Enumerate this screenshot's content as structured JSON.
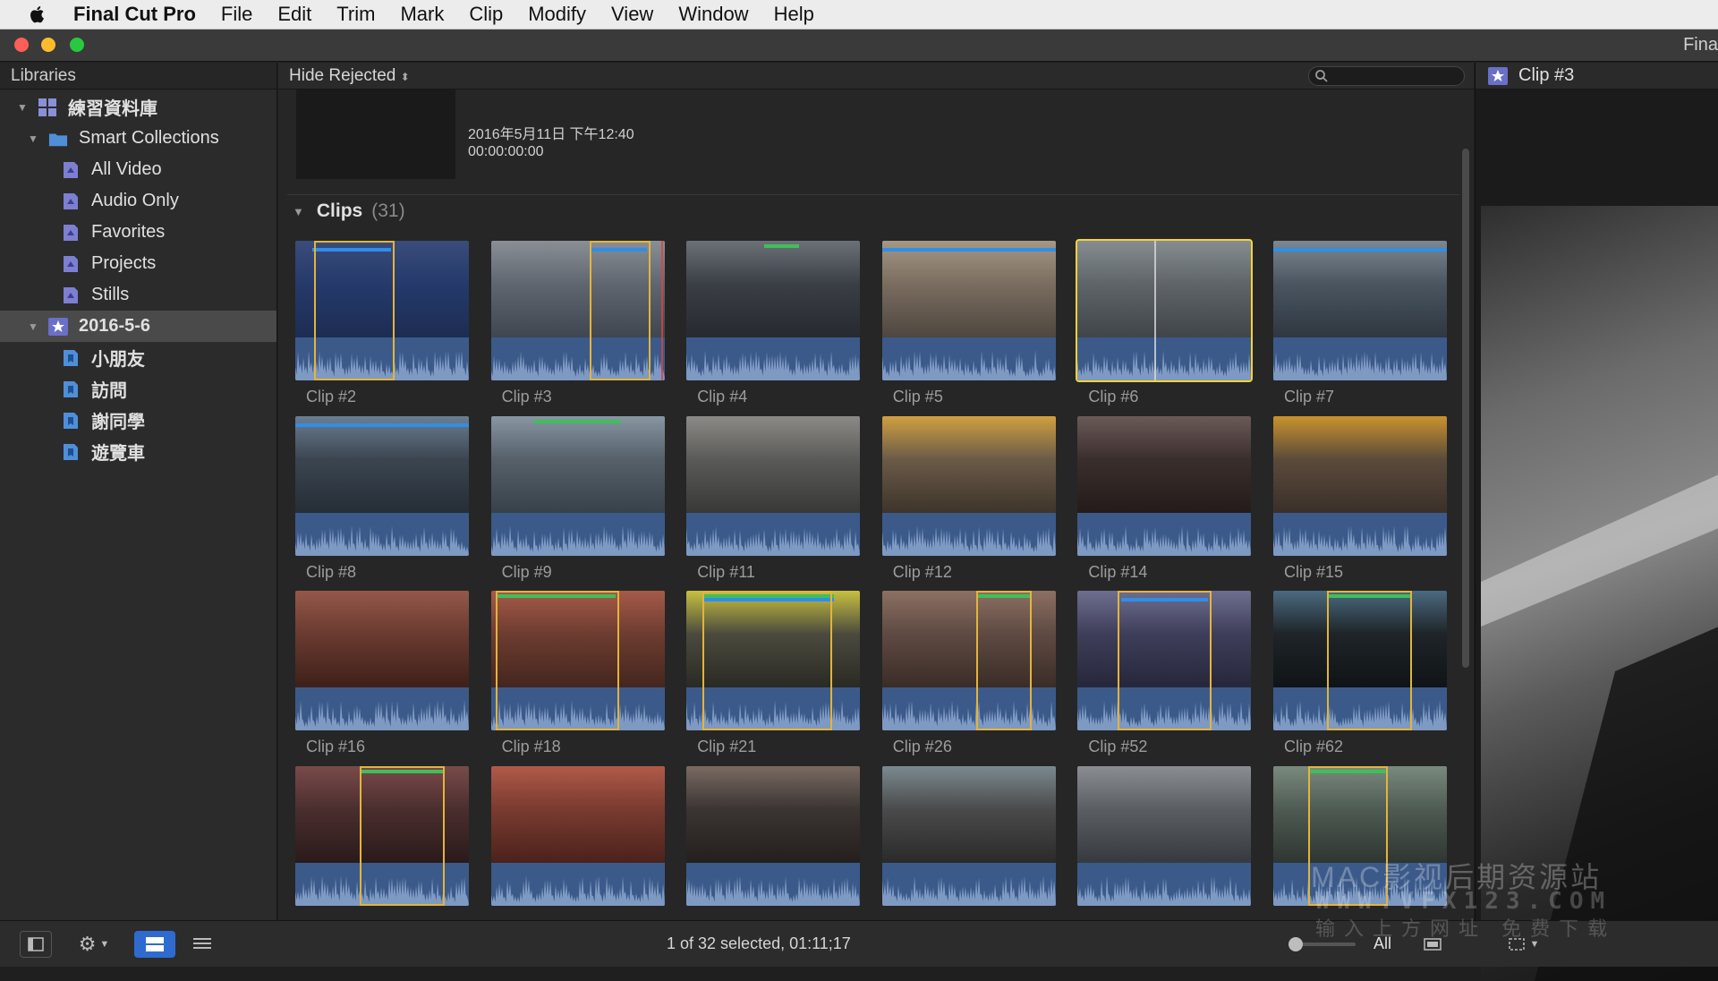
{
  "menubar": {
    "app_name": "Final Cut Pro",
    "items": [
      "File",
      "Edit",
      "Trim",
      "Mark",
      "Clip",
      "Modify",
      "View",
      "Window",
      "Help"
    ]
  },
  "window": {
    "title": "Fina"
  },
  "sidebar": {
    "header": "Libraries",
    "library": "練習資料庫",
    "smart_collections": "Smart Collections",
    "collections": [
      "All Video",
      "Audio Only",
      "Favorites",
      "Projects",
      "Stills"
    ],
    "event": "2016-5-6",
    "keywords": [
      "小朋友",
      "訪問",
      "謝同學",
      "遊覽車"
    ]
  },
  "browser": {
    "filter": "Hide Rejected",
    "event_date": "2016年5月11日 下午12:40",
    "event_timecode": "00:00:00:00",
    "clips_title": "Clips",
    "clips_count": "(31)",
    "clips": [
      {
        "name": "Clip #2"
      },
      {
        "name": "Clip #3"
      },
      {
        "name": "Clip #4"
      },
      {
        "name": "Clip #5"
      },
      {
        "name": "Clip #6"
      },
      {
        "name": "Clip #7"
      },
      {
        "name": "Clip #8"
      },
      {
        "name": "Clip #9"
      },
      {
        "name": "Clip #11"
      },
      {
        "name": "Clip #12"
      },
      {
        "name": "Clip #14"
      },
      {
        "name": "Clip #15"
      },
      {
        "name": "Clip #16"
      },
      {
        "name": "Clip #18"
      },
      {
        "name": "Clip #21"
      },
      {
        "name": "Clip #26"
      },
      {
        "name": "Clip #52"
      },
      {
        "name": "Clip #62"
      },
      {
        "name": ""
      },
      {
        "name": ""
      },
      {
        "name": ""
      },
      {
        "name": ""
      },
      {
        "name": ""
      },
      {
        "name": ""
      }
    ],
    "selected_clip": "Clip #6"
  },
  "viewer": {
    "title": "Clip #3"
  },
  "status": {
    "text": "1 of 32 selected, 01:11;17",
    "zoom_label": "All"
  },
  "watermark": {
    "line1": "MAC影视后期资源站",
    "line2": "WWW.VFX123.COM",
    "line3": "输入上方网址 免费下载"
  },
  "colors": {
    "keyword_blue": "#2f8fe8",
    "favorite_green": "#3fbf5a",
    "range_yellow": "#e3b43b",
    "audio_blue": "#3b5a8a",
    "selection_yellow": "#f6d23a"
  }
}
